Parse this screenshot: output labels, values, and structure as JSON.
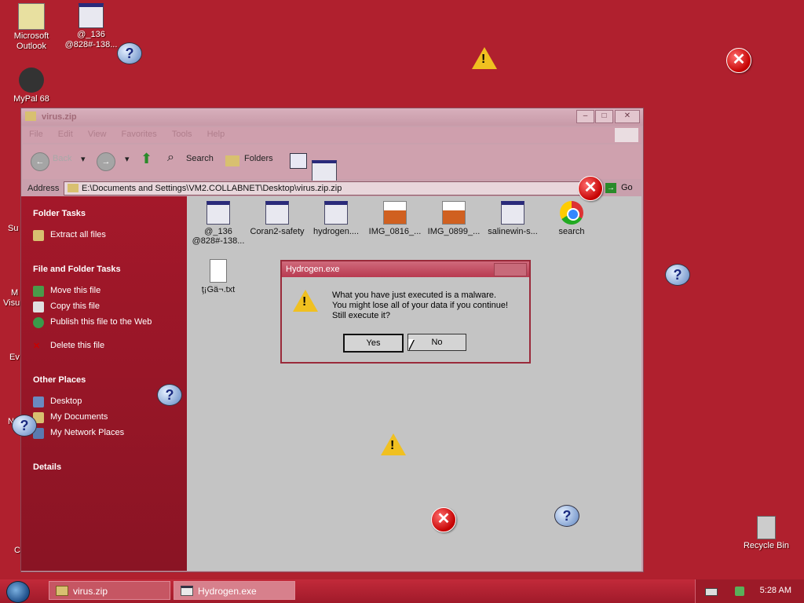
{
  "desktop": {
    "icons": [
      {
        "label": "Microsoft Outlook"
      },
      {
        "label": "@_136 @828#-138..."
      },
      {
        "label": "MyPal 68"
      },
      {
        "label": "Recycle Bin"
      }
    ],
    "edge_fragments": [
      "Su",
      "M",
      "Visu",
      "Ev",
      "N",
      "C"
    ]
  },
  "explorer": {
    "title": "virus.zip",
    "menu": [
      "File",
      "Edit",
      "View",
      "Favorites",
      "Tools",
      "Help"
    ],
    "toolbar": {
      "back": "Back",
      "search": "Search",
      "folders": "Folders"
    },
    "address": {
      "label": "Address",
      "value": "E:\\Documents and Settings\\VM2.COLLABNET\\Desktop\\virus.zip.zip",
      "go": "Go"
    },
    "sidebar": {
      "folder_tasks": {
        "heading": "Folder Tasks",
        "items": [
          "Extract all files"
        ]
      },
      "file_tasks": {
        "heading": "File and Folder Tasks",
        "items": [
          "Move this file",
          "Copy this file",
          "Publish this file to the Web",
          "Delete this file"
        ]
      },
      "other_places": {
        "heading": "Other Places",
        "items": [
          "Desktop",
          "My Documents",
          "My Network Places"
        ]
      },
      "details": {
        "heading": "Details"
      }
    },
    "files": [
      {
        "name": "@_136 @828#-138...",
        "icon": "window-icon"
      },
      {
        "name": "Coran2-safety",
        "icon": "window-icon"
      },
      {
        "name": "hydrogen....",
        "icon": "window-icon"
      },
      {
        "name": "IMG_0816_...",
        "icon": "image-icon"
      },
      {
        "name": "IMG_0899_...",
        "icon": "image-icon"
      },
      {
        "name": "salinewin-s...",
        "icon": "window-icon"
      },
      {
        "name": "search",
        "icon": "chrome-icon"
      },
      {
        "name": "ţ¡Gä¬.txt",
        "icon": "text-file-icon"
      }
    ]
  },
  "dialog": {
    "title": "Hydrogen.exe",
    "lines": [
      "What you have just executed is a malware.",
      "You might lose all of your data if you continue!",
      "Still execute it?"
    ],
    "yes": "Yes",
    "no": "No"
  },
  "taskbar": {
    "tasks": [
      "virus.zip",
      "Hydrogen.exe"
    ],
    "clock": "5:28 AM"
  },
  "colors": {
    "desktop": "#b0202e",
    "sidebar": "#a4182a",
    "taskbar": "#c22a3a"
  }
}
